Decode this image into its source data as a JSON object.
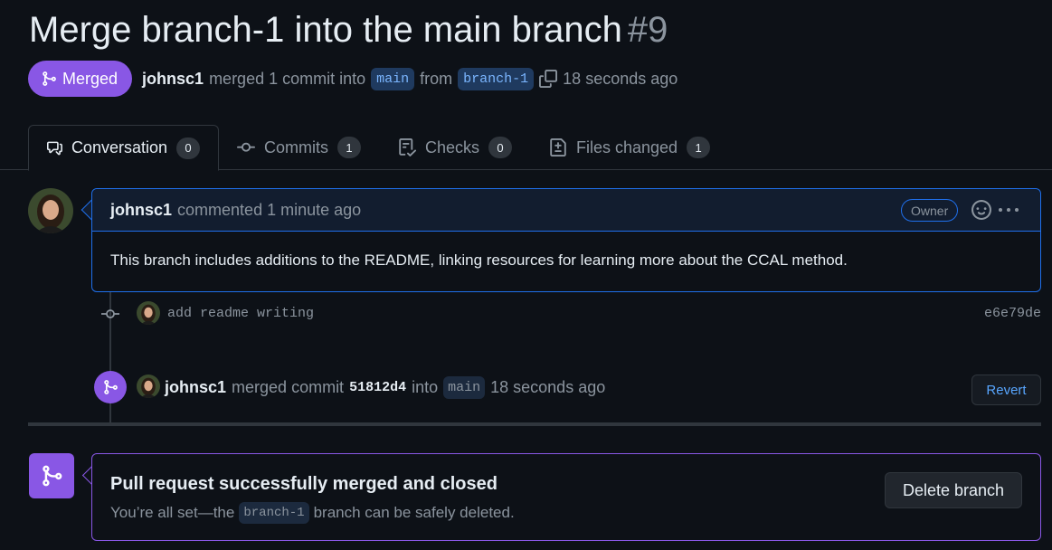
{
  "pr": {
    "title": "Merge branch-1 into the main branch",
    "number": "#9",
    "state_label": "Merged",
    "author": "johnsc1",
    "merged_text": "merged 1 commit into",
    "base_branch": "main",
    "from_text": "from",
    "head_branch": "branch-1",
    "time": "18 seconds ago"
  },
  "tabs": [
    {
      "label": "Conversation",
      "count": "0",
      "icon": "comment-discussion-icon"
    },
    {
      "label": "Commits",
      "count": "1",
      "icon": "git-commit-icon"
    },
    {
      "label": "Checks",
      "count": "0",
      "icon": "checklist-icon"
    },
    {
      "label": "Files changed",
      "count": "1",
      "icon": "file-diff-icon"
    }
  ],
  "comment": {
    "author": "johnsc1",
    "action": "commented 1 minute ago",
    "role": "Owner",
    "body": "This branch includes additions to the README, linking resources for learning more about the CCAL method."
  },
  "commit": {
    "message": "add readme writing",
    "sha": "e6e79de"
  },
  "merge_event": {
    "author": "johnsc1",
    "text": "merged commit",
    "sha": "51812d4",
    "into": "into",
    "branch": "main",
    "time": "18 seconds ago",
    "revert_label": "Revert"
  },
  "merged_box": {
    "title": "Pull request successfully merged and closed",
    "sub_prefix": "You’re all set—the",
    "branch": "branch-1",
    "sub_suffix": "branch can be safely deleted.",
    "delete_label": "Delete branch"
  },
  "colors": {
    "merged_purple": "#8957e5",
    "link_blue": "#58a6ff",
    "bg": "#0d1117"
  }
}
